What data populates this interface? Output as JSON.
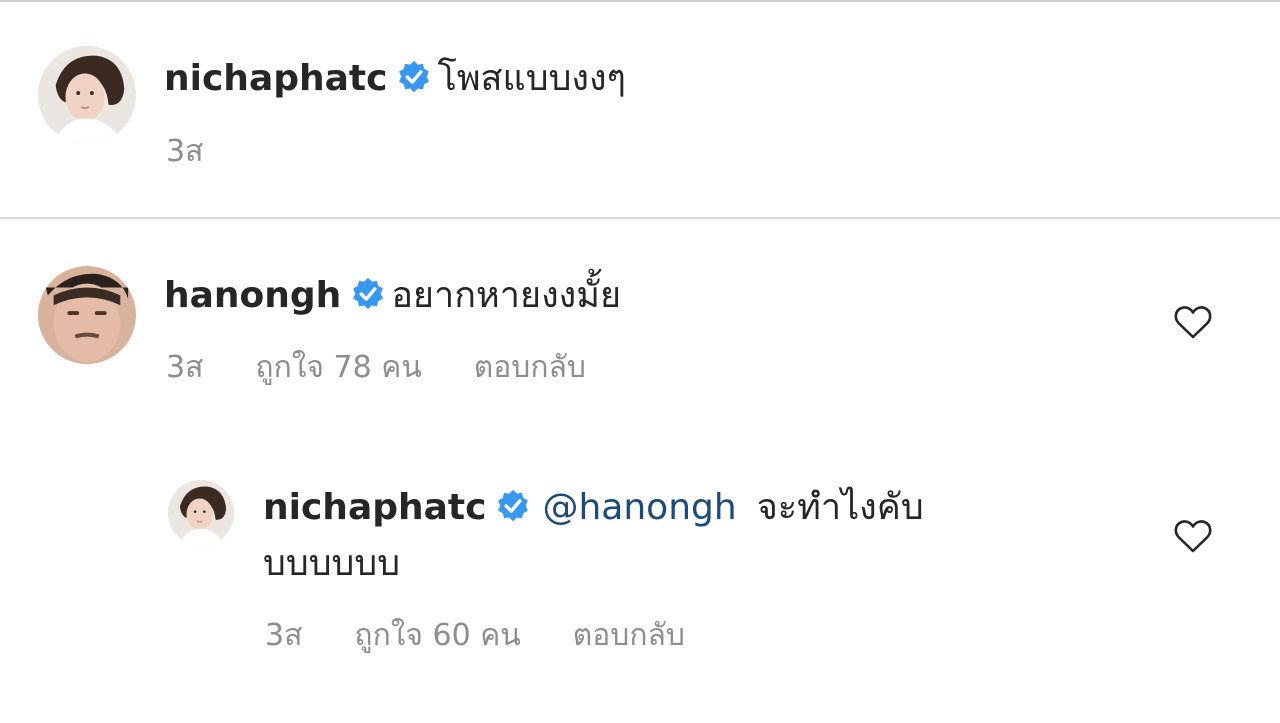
{
  "caption": {
    "username": "nichaphatc",
    "text": "โพสแบบงงๆ",
    "time": "3ส"
  },
  "comments": [
    {
      "username": "hanongh",
      "text": "อยากหายงงมั้ย",
      "time": "3ส",
      "likes": "ถูกใจ 78 คน",
      "reply": "ตอบกลับ"
    }
  ],
  "replies": [
    {
      "username": "nichaphatc",
      "mention": "@hanongh",
      "text_line1": "จะทำไงคับ",
      "text_line2": "บบบบบบ",
      "time": "3ส",
      "likes": "ถูกใจ 60 คน",
      "reply": "ตอบกลับ"
    }
  ],
  "icons": {
    "verified": "verified-badge-icon",
    "like": "heart-outline-icon"
  },
  "colors": {
    "verified_blue": "#3897f0",
    "mention_blue": "#1c4a7a",
    "meta_gray": "#8e8e8e"
  }
}
